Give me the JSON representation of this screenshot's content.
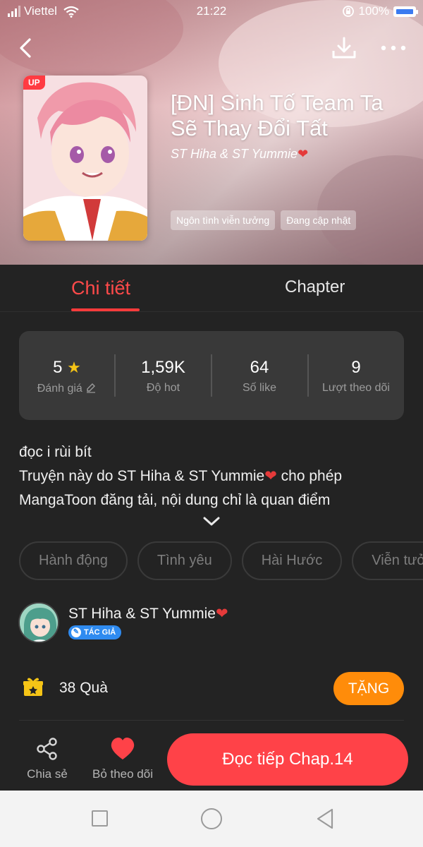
{
  "status_bar": {
    "carrier": "Viettel",
    "time": "21:22",
    "battery": "100%"
  },
  "book": {
    "title": "[ĐN] Sinh Tố Team Ta Sẽ Thay Đổi Tất",
    "author": "ST Hiha & ST Yummie",
    "badge": "UP",
    "tags": [
      "Ngôn tình viễn tưởng",
      "Đang cập nhật"
    ]
  },
  "tabs": {
    "detail": "Chi tiết",
    "chapter": "Chapter"
  },
  "stats": [
    {
      "value": "5",
      "label": "Đánh giá"
    },
    {
      "value": "1,59K",
      "label": "Độ hot"
    },
    {
      "value": "64",
      "label": "Số like"
    },
    {
      "value": "9",
      "label": "Lượt theo dõi"
    }
  ],
  "description": {
    "line1": "đọc i rùi bít",
    "line2a": "Truyện này do ST Hiha & ST Yummie",
    "line2b": " cho phép",
    "line3": "MangaToon đăng tải, nội dung chỉ là quan điểm"
  },
  "genres": [
    "Hành động",
    "Tình yêu",
    "Hài Hước",
    "Viễn tưởng"
  ],
  "author_section": {
    "name": "ST Hiha & ST Yummie",
    "badge": "TÁC GIẢ"
  },
  "gifts": {
    "count": "38",
    "label": "Quà",
    "button": "TẶNG"
  },
  "actions": {
    "share": "Chia sẻ",
    "unfollow": "Bỏ theo dõi",
    "read": "Đọc tiếp Chap.14"
  },
  "colors": {
    "accent": "#ff4248",
    "gift_button": "#ff8c0a",
    "background": "#232323"
  }
}
